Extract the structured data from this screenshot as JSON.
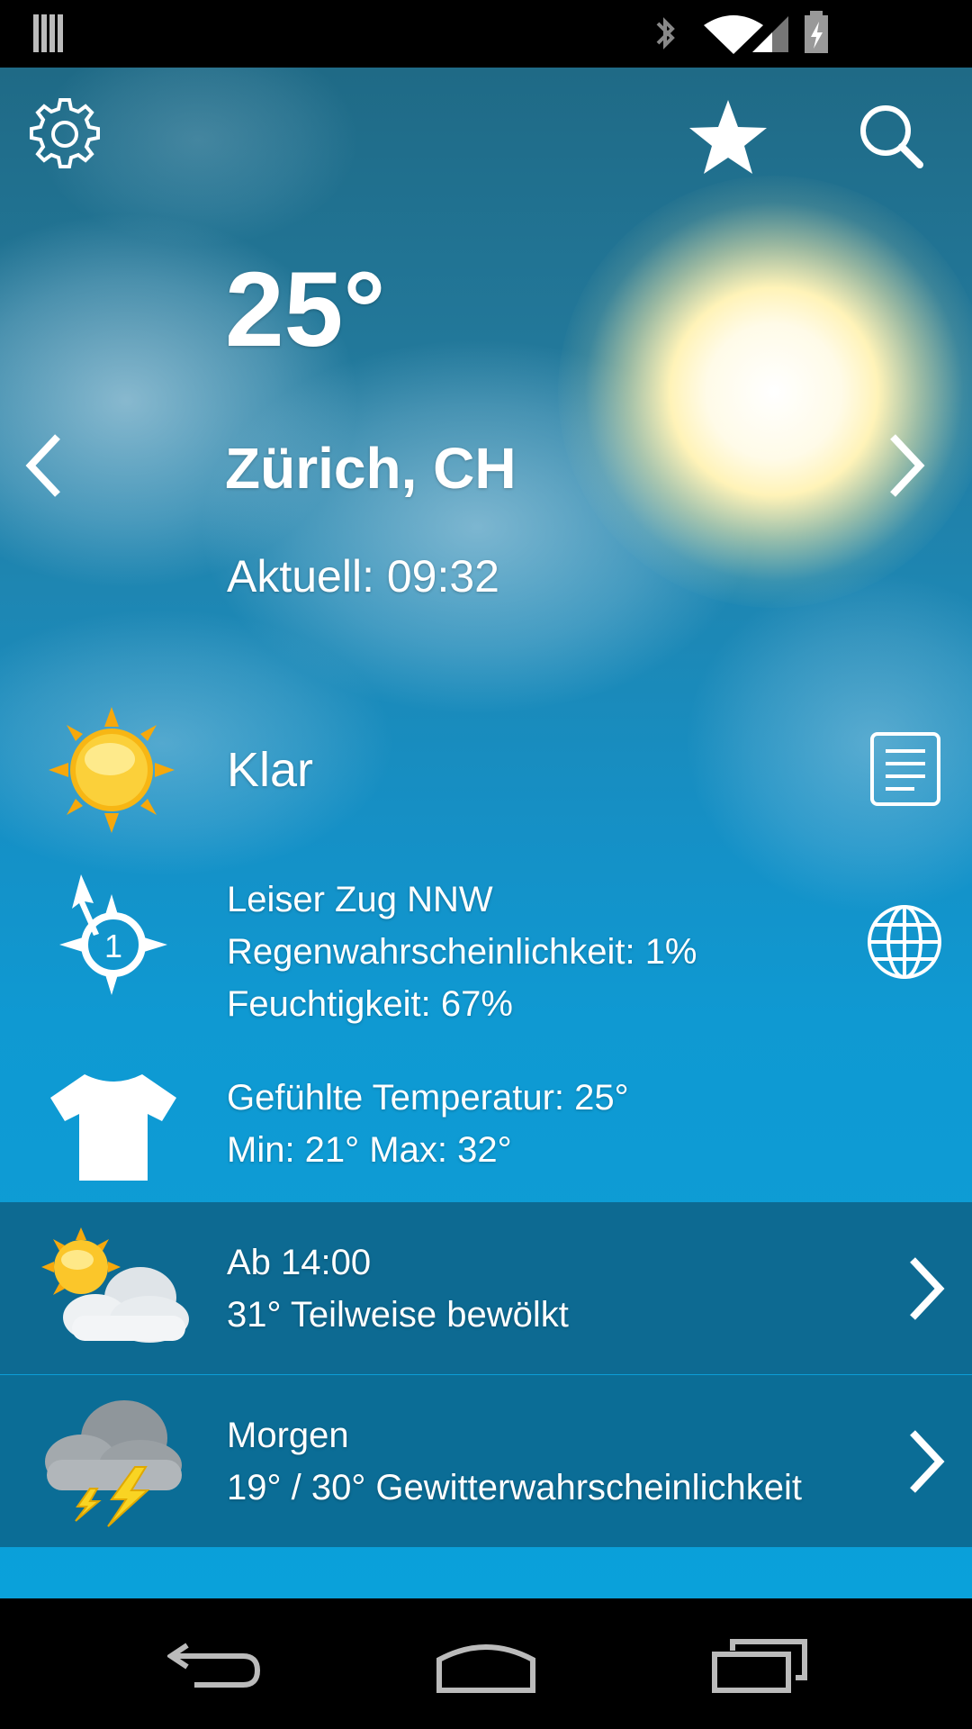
{
  "status_bar": {
    "icons": [
      "notification-bars-icon",
      "bluetooth-icon",
      "wifi-icon",
      "signal-icon",
      "battery-charging-icon"
    ]
  },
  "toolbar": {
    "settings_icon": "gear-icon",
    "favorite_icon": "star-icon",
    "search_icon": "search-icon"
  },
  "current": {
    "temperature": "25°",
    "location": "Zürich, CH",
    "updated": "Aktuell: 09:32",
    "condition": "Klar",
    "wind": "Leiser Zug NNW",
    "rain_probability": "Regenwahrscheinlichkeit: 1%",
    "humidity": "Feuchtigkeit: 67%",
    "wind_speed_badge": "1",
    "feels_like": "Gefühlte Temperatur: 25°",
    "min_max": "Min: 21° Max: 32°"
  },
  "forecast": [
    {
      "time": "Ab 14:00",
      "summary": "31° Teilweise bewölkt",
      "icon": "partly-cloudy-icon"
    },
    {
      "time": "Morgen",
      "summary": "19° / 30° Gewitterwahrscheinlichkeit",
      "icon": "thunderstorm-icon"
    }
  ],
  "colors": {
    "accent": "#0aa1da",
    "row_dark": "#0d6a92"
  }
}
